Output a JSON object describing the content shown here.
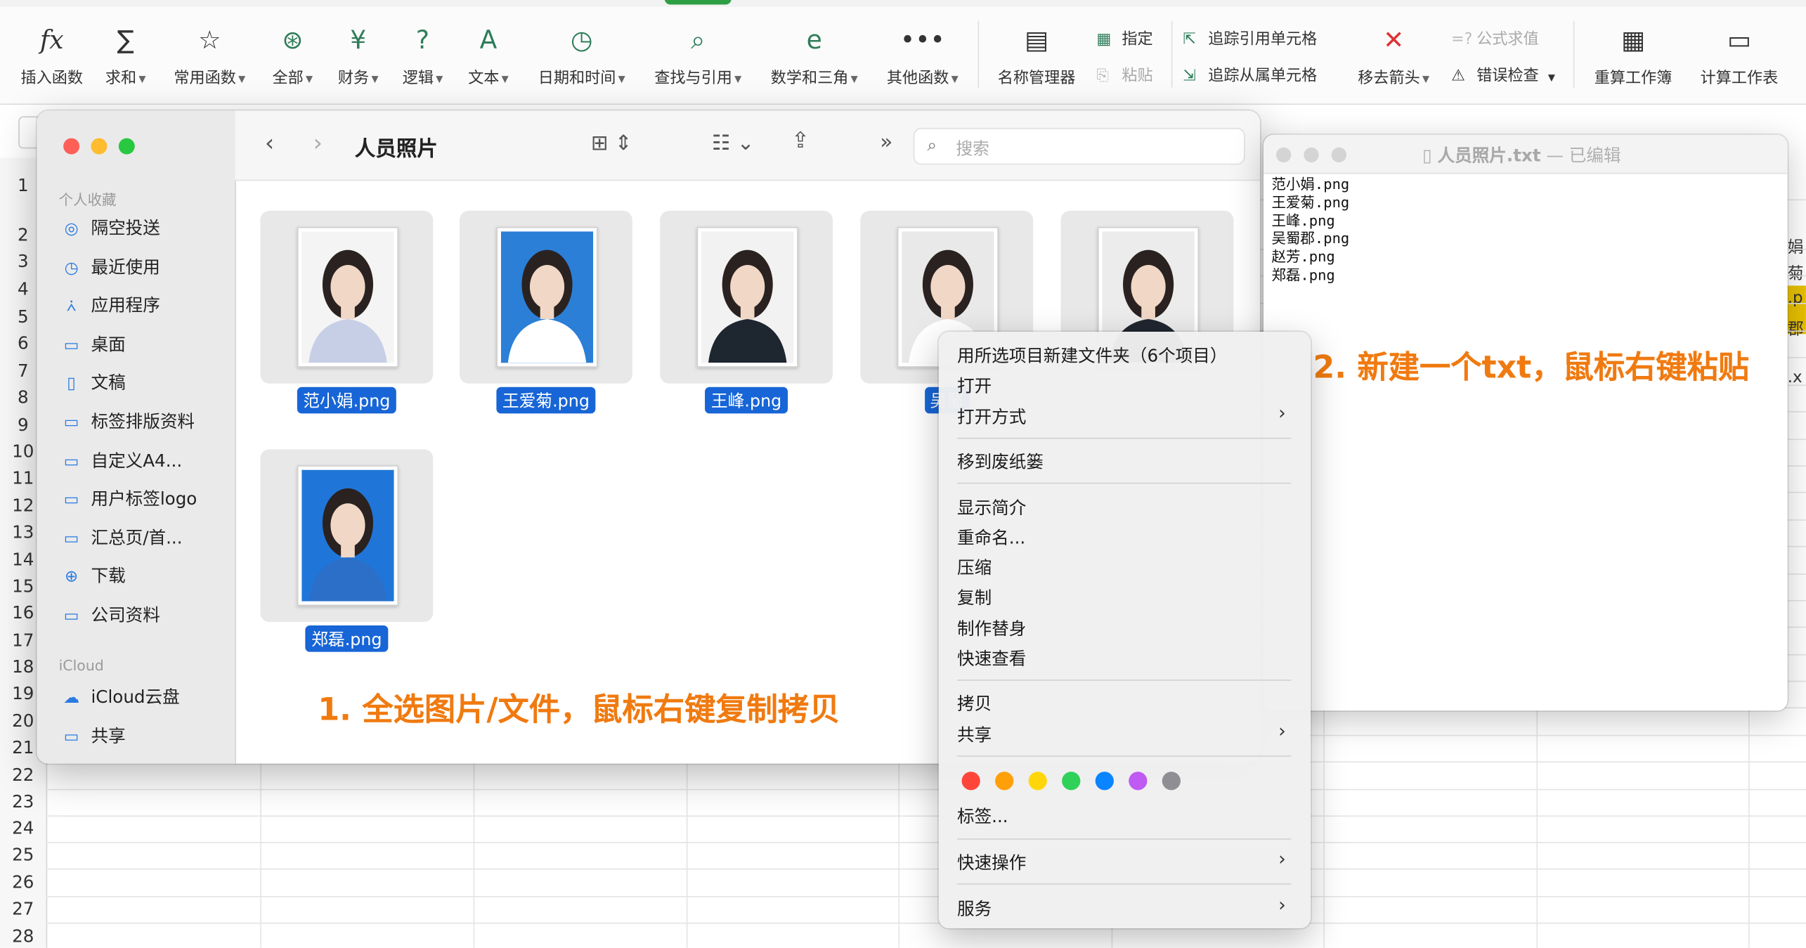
{
  "ribbon": {
    "insert_fn": "插入函数",
    "sum": "求和",
    "common_fn": "常用函数",
    "all": "全部",
    "finance": "财务",
    "logic": "逻辑",
    "text": "文本",
    "datetime": "日期和时间",
    "lookup": "查找与引用",
    "math": "数学和三角",
    "other_fn": "其他函数",
    "name_mgr": "名称管理器",
    "assign": "指定",
    "paste": "粘贴",
    "trace_prec": "追踪引用单元格",
    "trace_dep": "追踪从属单元格",
    "remove_arrows": "移去箭头",
    "formula_eval": "公式求值",
    "error_check": "错误检查",
    "recalc_book": "重算工作簿",
    "calc_sheet": "计算工作表"
  },
  "sheet": {
    "rows": [
      "1",
      "2",
      "3",
      "4",
      "5",
      "6",
      "7",
      "8",
      "9",
      "10",
      "11",
      "12",
      "13",
      "14",
      "15",
      "16",
      "17",
      "18",
      "19",
      "20",
      "21",
      "22",
      "23",
      "24",
      "25",
      "26",
      "27",
      "28"
    ],
    "right_fragments": [
      "娟",
      "菊",
      ".p",
      "郡",
      ".x"
    ]
  },
  "finder": {
    "title": "人员照片",
    "search_placeholder": "搜索",
    "sidebar_favorites_head": "个人收藏",
    "sidebar_favorites": [
      {
        "label": "隔空投送",
        "icon": "airdrop-icon"
      },
      {
        "label": "最近使用",
        "icon": "clock-icon"
      },
      {
        "label": "应用程序",
        "icon": "apps-icon"
      },
      {
        "label": "桌面",
        "icon": "desktop-icon"
      },
      {
        "label": "文稿",
        "icon": "document-icon"
      },
      {
        "label": "标签排版资料",
        "icon": "folder-icon"
      },
      {
        "label": "自定义A4...",
        "icon": "folder-icon"
      },
      {
        "label": "用户标签logo",
        "icon": "folder-icon"
      },
      {
        "label": "汇总页/首...",
        "icon": "folder-icon"
      },
      {
        "label": "下载",
        "icon": "download-icon"
      },
      {
        "label": "公司资料",
        "icon": "folder-icon"
      }
    ],
    "sidebar_icloud_head": "iCloud",
    "sidebar_icloud": [
      {
        "label": "iCloud云盘",
        "icon": "cloud-icon"
      },
      {
        "label": "共享",
        "icon": "shared-folder-icon"
      }
    ],
    "files": [
      {
        "name": "范小娟.png",
        "bg": "#f4f4f4"
      },
      {
        "name": "王爱菊.png",
        "bg": "#2b7fd6"
      },
      {
        "name": "王峰.png",
        "bg": "#f2f2f2"
      },
      {
        "name": "吴蜀",
        "bg": "#e9e9e9"
      },
      {
        "name": "",
        "bg": "#ececec"
      },
      {
        "name": "郑磊.png",
        "bg": "#1f76d8"
      }
    ]
  },
  "annotations": {
    "step1": "1. 全选图片/文件，鼠标右键复制拷贝",
    "step2": "2. 新建一个txt，鼠标右键粘贴"
  },
  "editor": {
    "title": "人员照片.txt",
    "status": " — 已编辑",
    "lines": [
      "范小娟.png",
      "王爱菊.png",
      "王峰.png",
      "吴蜀郡.png",
      "赵芳.png",
      "郑磊.png"
    ]
  },
  "context_menu": {
    "new_folder": "用所选项目新建文件夹（6个项目）",
    "open": "打开",
    "open_with": "打开方式",
    "trash": "移到废纸篓",
    "get_info": "显示简介",
    "rename": "重命名...",
    "compress": "压缩",
    "duplicate": "复制",
    "make_alias": "制作替身",
    "quick_look": "快速查看",
    "copy": "拷贝",
    "share": "共享",
    "tag_colors": [
      "#ff453a",
      "#ff9f0a",
      "#ffd60a",
      "#30d158",
      "#0a84ff",
      "#bf5af2",
      "#8e8e93"
    ],
    "tags": "标签...",
    "quick_actions": "快速操作",
    "services": "服务"
  }
}
